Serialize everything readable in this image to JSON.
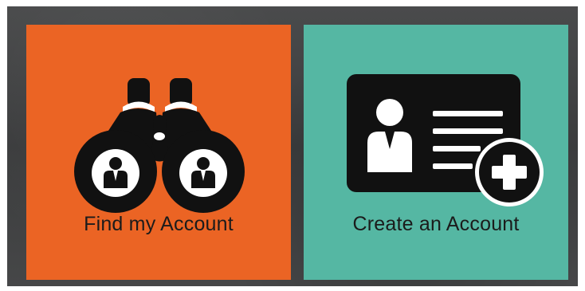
{
  "tiles": {
    "find": {
      "label": "Find my Account",
      "icon": "binoculars-icon",
      "background": "#eb6424"
    },
    "create": {
      "label": "Create an Account",
      "icon": "id-card-add-icon",
      "background": "#55b7a3"
    }
  },
  "colors": {
    "frame": "#424344",
    "icon": "#111111",
    "icon_detail": "#ffffff"
  }
}
